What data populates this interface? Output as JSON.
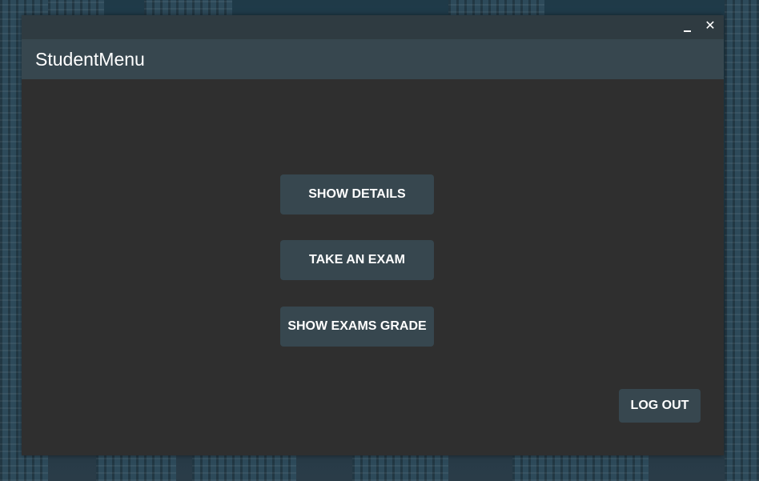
{
  "window": {
    "title": "StudentMenu",
    "controls": {
      "minimize_icon": "minimize-icon",
      "close_icon": "close-icon",
      "close_glyph": "✕"
    }
  },
  "menu": {
    "show_details": "SHOW DETAILS",
    "take_exam": "TAKE AN EXAM",
    "show_grades": "SHOW EXAMS GRADE"
  },
  "footer": {
    "logout": "LOG OUT"
  },
  "colors": {
    "window_bg": "#2f2f2f",
    "titlebar_bg": "#2f3b41",
    "header_bg": "#37474f",
    "button_bg": "#37474f",
    "text": "#ffffff"
  }
}
